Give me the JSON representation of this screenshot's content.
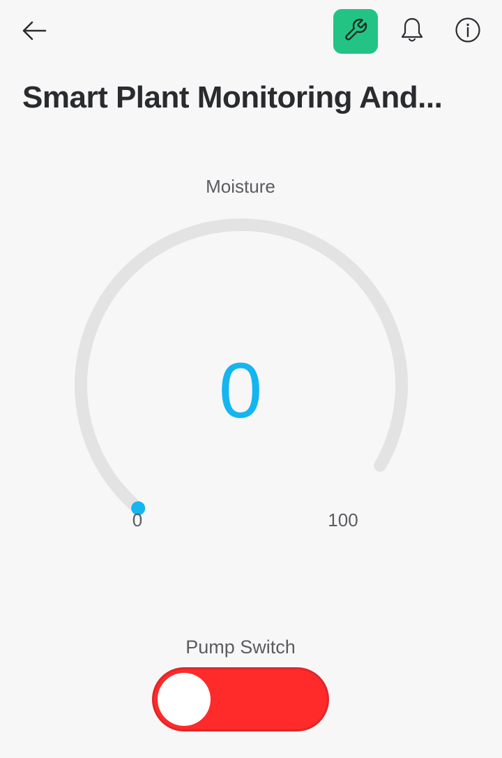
{
  "header": {
    "back_icon": "arrow-left-icon",
    "settings_icon": "wrench-icon",
    "notifications_icon": "bell-icon",
    "info_icon": "info-circle-icon",
    "accent_color": "#23c483"
  },
  "page": {
    "title": "Smart Plant Monitoring And..."
  },
  "gauge": {
    "label": "Moisture",
    "value": "0",
    "min": "0",
    "max": "100",
    "fraction": 0,
    "track_color": "#e3e3e3",
    "value_color": "#14b5f0"
  },
  "pump_switch": {
    "label": "Pump Switch",
    "state": "off",
    "color": "#ff2a2a",
    "border_color": "#e0262a"
  }
}
